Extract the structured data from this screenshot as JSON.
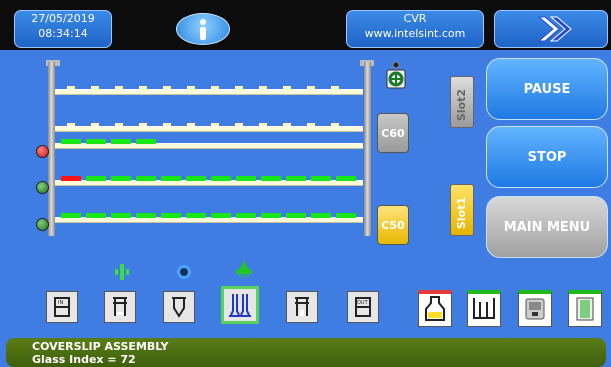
{
  "header": {
    "date": "27/05/2019",
    "time": "08:34:14",
    "site_name": "CVR",
    "site_url": "www.intelsint.com"
  },
  "rack": {
    "c_boxes": [
      "C60",
      "C50"
    ],
    "slots": [
      "Slot2",
      "Slot1"
    ]
  },
  "buttons": {
    "pause": "PAUSE",
    "stop": "STOP",
    "main_menu": "MAIN MENU"
  },
  "status": {
    "line1": "COVERSLIP ASSEMBLY",
    "line2": "Glass Index = 72"
  },
  "colors": {
    "active_segment": "#17e617",
    "error_segment": "#ff1414",
    "led_red": "#d42020",
    "led_green": "#2a8c2a",
    "status_bar": "#4a6f12"
  }
}
